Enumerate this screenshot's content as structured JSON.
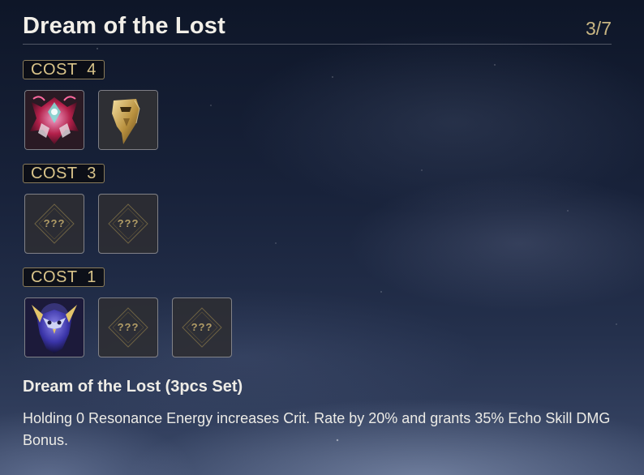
{
  "header": {
    "title": "Dream of the Lost",
    "progress": "3/7"
  },
  "groups": [
    {
      "cost_label": "COST  4",
      "slots": [
        {
          "state": "collected",
          "icon": "red-crystal-beast-echo-icon"
        },
        {
          "state": "collected",
          "icon": "golden-mask-echo-icon"
        }
      ]
    },
    {
      "cost_label": "COST  3",
      "slots": [
        {
          "state": "unknown",
          "label": "???"
        },
        {
          "state": "unknown",
          "label": "???"
        }
      ]
    },
    {
      "cost_label": "COST  1",
      "slots": [
        {
          "state": "collected",
          "icon": "purple-owl-echo-icon"
        },
        {
          "state": "unknown",
          "label": "???"
        },
        {
          "state": "unknown",
          "label": "???"
        }
      ]
    }
  ],
  "set_bonus": {
    "name": "Dream of the Lost (3pcs Set)",
    "description": "Holding 0 Resonance Energy increases Crit. Rate by 20% and grants 35% Echo Skill DMG Bonus."
  },
  "colors": {
    "accent_gold": "#c9b683",
    "badge_border": "#8a7c5a",
    "text": "#ecebe6"
  }
}
